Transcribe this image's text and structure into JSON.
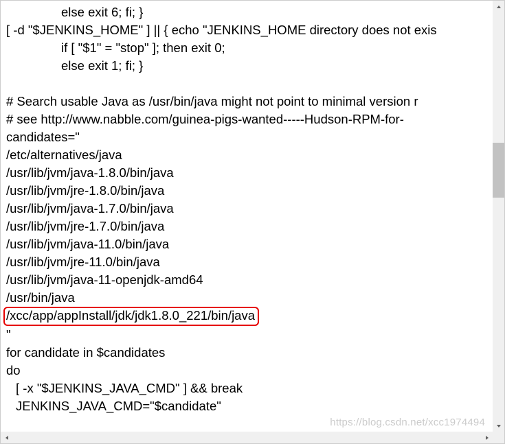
{
  "code": {
    "lines": [
      {
        "text": "else exit 6; fi; }",
        "indent": "indent1"
      },
      {
        "text": "[ -d \"$JENKINS_HOME\" ] || { echo \"JENKINS_HOME directory does not exis",
        "indent": ""
      },
      {
        "text": "if [ \"$1\" = \"stop\" ]; then exit 0;",
        "indent": "indent1"
      },
      {
        "text": "else exit 1; fi; }",
        "indent": "indent1"
      },
      {
        "text": "",
        "indent": ""
      },
      {
        "text": "# Search usable Java as /usr/bin/java might not point to minimal version r",
        "indent": ""
      },
      {
        "text": "# see http://www.nabble.com/guinea-pigs-wanted-----Hudson-RPM-for-",
        "indent": ""
      },
      {
        "text": "candidates=\"",
        "indent": ""
      },
      {
        "text": "/etc/alternatives/java",
        "indent": ""
      },
      {
        "text": "/usr/lib/jvm/java-1.8.0/bin/java",
        "indent": ""
      },
      {
        "text": "/usr/lib/jvm/jre-1.8.0/bin/java",
        "indent": ""
      },
      {
        "text": "/usr/lib/jvm/java-1.7.0/bin/java",
        "indent": ""
      },
      {
        "text": "/usr/lib/jvm/jre-1.7.0/bin/java",
        "indent": ""
      },
      {
        "text": "/usr/lib/jvm/java-11.0/bin/java",
        "indent": ""
      },
      {
        "text": "/usr/lib/jvm/jre-11.0/bin/java",
        "indent": ""
      },
      {
        "text": "/usr/lib/jvm/java-11-openjdk-amd64",
        "indent": ""
      },
      {
        "text": "/usr/bin/java",
        "indent": ""
      },
      {
        "text": "/xcc/app/appInstall/jdk/jdk1.8.0_221/bin/java",
        "indent": "",
        "highlight": true
      },
      {
        "text": "\"",
        "indent": ""
      },
      {
        "text": "for candidate in $candidates",
        "indent": ""
      },
      {
        "text": "do",
        "indent": ""
      },
      {
        "text": "[ -x \"$JENKINS_JAVA_CMD\" ] && break",
        "indent": "indent2"
      },
      {
        "text": "JENKINS_JAVA_CMD=\"$candidate\"",
        "indent": "indent2"
      }
    ]
  },
  "watermark": "https://blog.csdn.net/xcc1974494"
}
